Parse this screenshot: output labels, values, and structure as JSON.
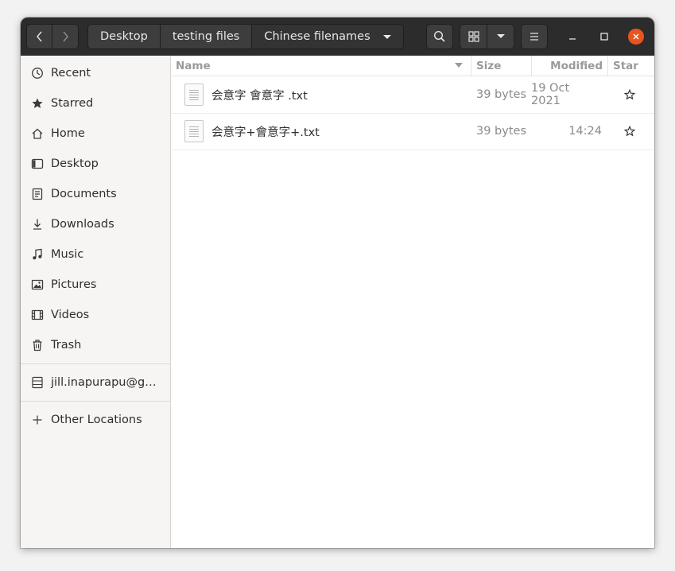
{
  "path_bar": {
    "crumbs": [
      {
        "label": "Desktop"
      },
      {
        "label": "testing files"
      },
      {
        "label": "Chinese filenames"
      }
    ]
  },
  "sidebar": {
    "items": [
      {
        "label": "Recent",
        "icon": "recent-icon"
      },
      {
        "label": "Starred",
        "icon": "star-icon"
      },
      {
        "label": "Home",
        "icon": "home-icon"
      },
      {
        "label": "Desktop",
        "icon": "desktop-icon"
      },
      {
        "label": "Documents",
        "icon": "documents-icon"
      },
      {
        "label": "Downloads",
        "icon": "downloads-icon"
      },
      {
        "label": "Music",
        "icon": "music-icon"
      },
      {
        "label": "Pictures",
        "icon": "pictures-icon"
      },
      {
        "label": "Videos",
        "icon": "videos-icon"
      },
      {
        "label": "Trash",
        "icon": "trash-icon"
      }
    ],
    "network": {
      "label": "jill.inapurapu@g…",
      "icon": "network-drive-icon"
    },
    "other_locations": {
      "label": "Other Locations",
      "icon": "plus-icon"
    }
  },
  "columns": {
    "name": "Name",
    "size": "Size",
    "modified": "Modified",
    "star": "Star"
  },
  "files": [
    {
      "name": "会意字 會意字 .txt",
      "size": "39 bytes",
      "modified": "19 Oct 2021"
    },
    {
      "name": "会意字+會意字+.txt",
      "size": "39 bytes",
      "modified": "14:24"
    }
  ],
  "colors": {
    "headerbar": "#2c2c2c",
    "close_button": "#e95420",
    "sidebar_bg": "#f6f5f4"
  }
}
